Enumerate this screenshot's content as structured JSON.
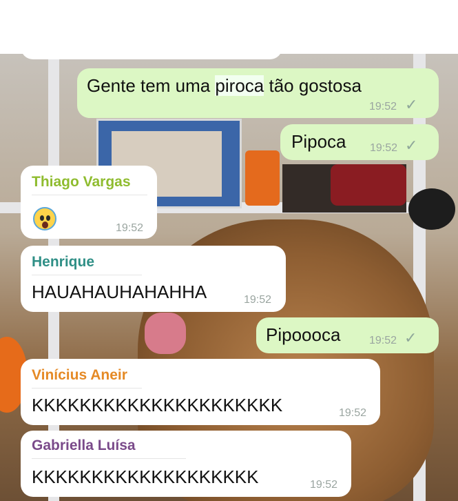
{
  "messages": [
    {
      "text_before": "Gente tem uma ",
      "highlight": "piroca",
      "text_after": " tão gostosa",
      "time": "19:52",
      "status": "✓"
    },
    {
      "text": "Pipoca",
      "time": "19:52",
      "status": "✓"
    },
    {
      "sender": "Thiago Vargas",
      "time": "19:52",
      "emoji": "screaming-face"
    },
    {
      "sender": "Henrique",
      "text": "HAUAHAUHAHAHHA",
      "time": "19:52"
    },
    {
      "text": "Pipoooca",
      "time": "19:52",
      "status": "✓"
    },
    {
      "sender": "Vinícius Aneir",
      "text": "KKKKKKKKKKKKKKKKKKKKK",
      "time": "19:52"
    },
    {
      "sender": "Gabriella Luísa",
      "text": "KKKKKKKKKKKKKKKKKKK",
      "time": "19:52"
    }
  ],
  "colors": {
    "outgoing_bubble": "#dcf7c4",
    "incoming_bubble": "#ffffff",
    "sender_thiago": "#8fbc2f",
    "sender_henrique": "#2f8f86",
    "sender_vinicius": "#e58a26",
    "sender_gabriella": "#7a4a8a"
  }
}
